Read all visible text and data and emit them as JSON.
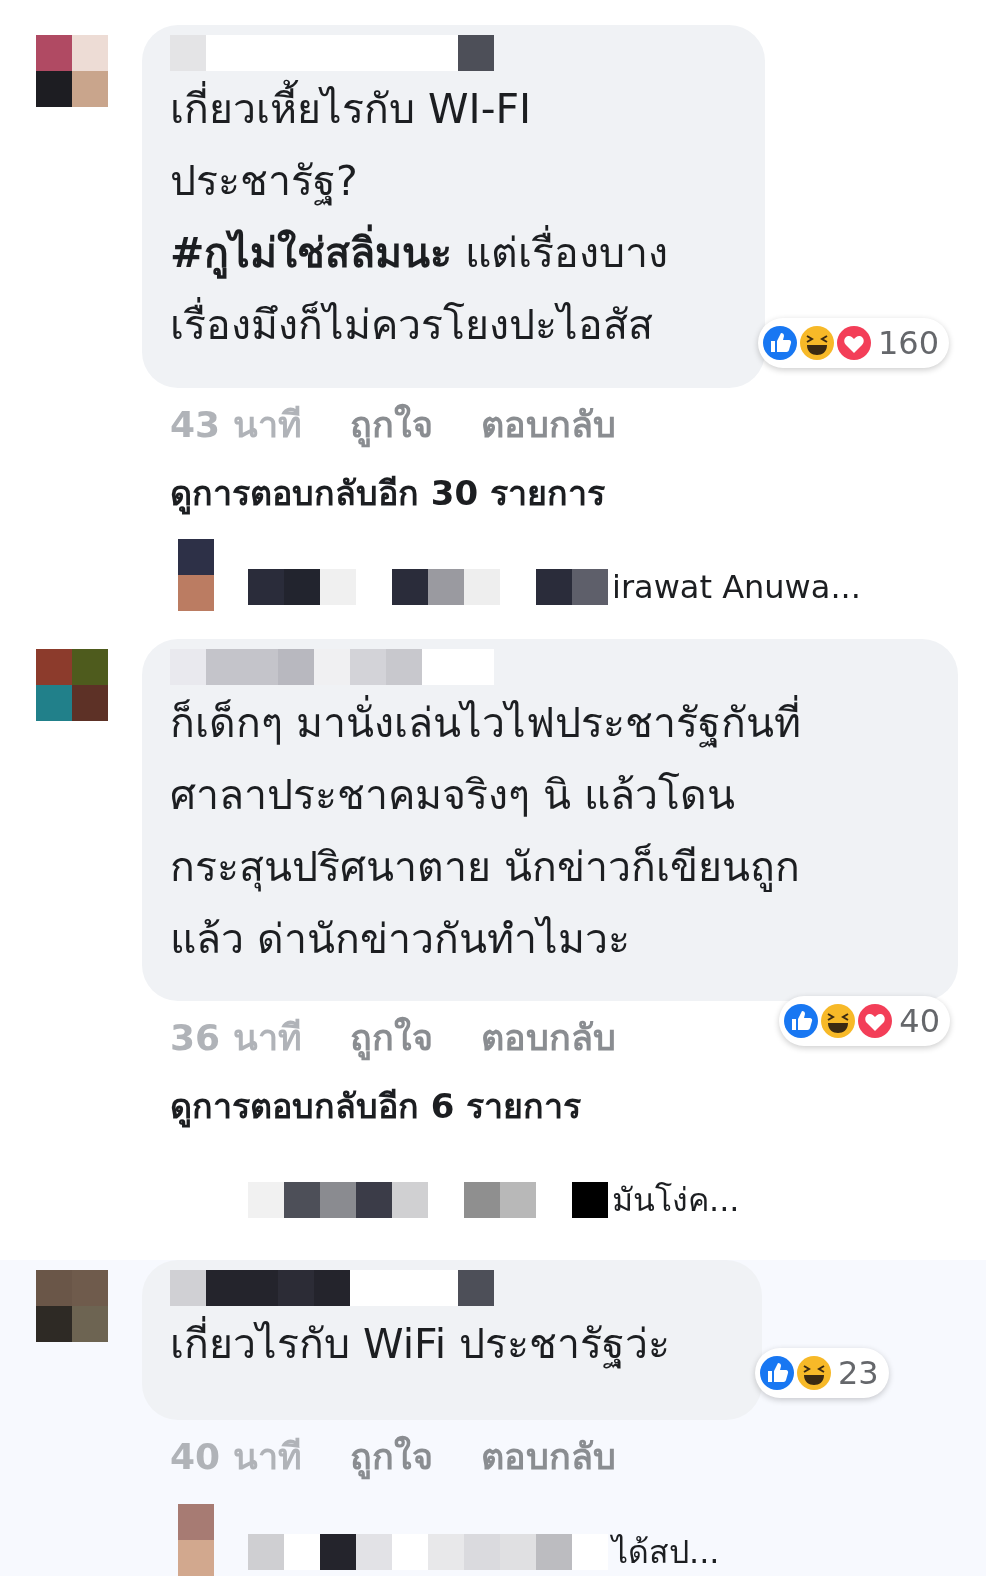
{
  "comments": [
    {
      "text": "เกี่ยวเหี้ยไรกับ WI-FI\nประชารัฐ?\n**#กูไม่ใช่สลิ่มนะ** แต่เรื่องบาง\nเรื่องมึงก็ไม่ควรโยงปะไอสัส",
      "reactions": [
        {
          "kind": "like"
        },
        {
          "kind": "haha"
        },
        {
          "kind": "love"
        }
      ],
      "reaction_count": "160",
      "time": "43 นาที",
      "actions": [
        "ถูกใจ",
        "ตอบกลับ"
      ],
      "view_replies": "ดูการตอบกลับอีก 30 รายการ",
      "reply_preview": "irawat Anuwa..."
    },
    {
      "text": "ก็เด็กๆ มานั่งเล่นไวไฟประชารัฐกันที่\nศาลาประชาคมจริงๆ นิ  แล้วโดน\nกระสุนปริศนาตาย  นักข่าวก็เขียนถูก\nแล้ว  ด่านักข่าวกันทำไมวะ",
      "reactions": [
        {
          "kind": "like"
        },
        {
          "kind": "haha"
        },
        {
          "kind": "love"
        }
      ],
      "reaction_count": "40",
      "time": "36 นาที",
      "actions": [
        "ถูกใจ",
        "ตอบกลับ"
      ],
      "view_replies": "ดูการตอบกลับอีก 6 รายการ",
      "reply_preview": "มันโง่ค..."
    },
    {
      "text": "เกี่ยวไรกับ WiFi ประชารัฐว่ะ",
      "reactions": [
        {
          "kind": "like"
        },
        {
          "kind": "haha"
        }
      ],
      "reaction_count": "23",
      "time": "40 นาที",
      "actions": [
        "ถูกใจ",
        "ตอบกลับ"
      ],
      "reply_preview": "ได้สป..."
    }
  ]
}
